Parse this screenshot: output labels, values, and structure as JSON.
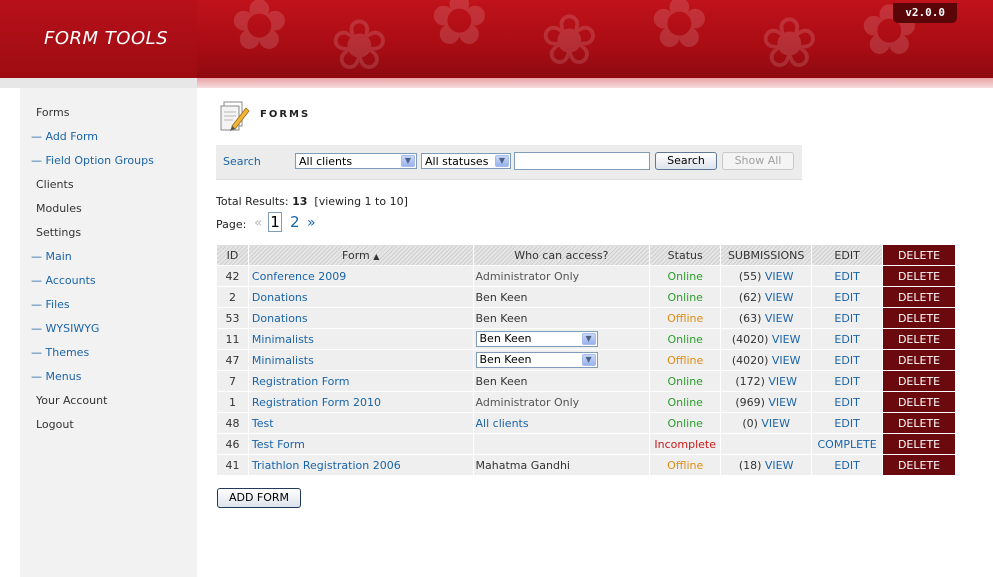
{
  "header": {
    "logo": "FORM TOOLS",
    "version": "v2.0.0"
  },
  "sidebar": {
    "items": [
      {
        "label": "Forms",
        "sub": false
      },
      {
        "label": "— Add Form",
        "sub": true
      },
      {
        "label": "— Field Option Groups",
        "sub": true
      },
      {
        "label": "Clients",
        "sub": false
      },
      {
        "label": "Modules",
        "sub": false
      },
      {
        "label": "Settings",
        "sub": false
      },
      {
        "label": "— Main",
        "sub": true
      },
      {
        "label": "— Accounts",
        "sub": true
      },
      {
        "label": "— Files",
        "sub": true
      },
      {
        "label": "— WYSIWYG",
        "sub": true
      },
      {
        "label": "— Themes",
        "sub": true
      },
      {
        "label": "— Menus",
        "sub": true
      },
      {
        "label": "Your Account",
        "sub": false
      },
      {
        "label": "Logout",
        "sub": false
      }
    ]
  },
  "page": {
    "title": "FORMS"
  },
  "search": {
    "label": "Search",
    "client_select": "All clients",
    "status_select": "All statuses",
    "keyword_value": "",
    "search_button": "Search",
    "show_all_button": "Show All"
  },
  "results": {
    "prefix": "Total Results: ",
    "total": "13",
    "viewing": "  [viewing 1 to 10]"
  },
  "pager": {
    "label": "Page:",
    "prev": "«",
    "current": "1",
    "page2": "2",
    "next": "»"
  },
  "table": {
    "headers": {
      "id": "ID",
      "form": "Form",
      "access": "Who can access?",
      "status": "Status",
      "submissions": "SUBMISSIONS",
      "edit": "EDIT",
      "delete": "DELETE"
    },
    "rows": [
      {
        "id": "42",
        "form": "Conference 2009",
        "access": "Administrator Only",
        "access_type": "admin",
        "status": "Online",
        "status_type": "online",
        "count": "(55)",
        "view": "VIEW",
        "edit": "EDIT",
        "delete": "DELETE"
      },
      {
        "id": "2",
        "form": "Donations",
        "access": "Ben Keen",
        "access_type": "text",
        "status": "Online",
        "status_type": "online",
        "count": "(62)",
        "view": "VIEW",
        "edit": "EDIT",
        "delete": "DELETE"
      },
      {
        "id": "53",
        "form": "Donations",
        "access": "Ben Keen",
        "access_type": "text",
        "status": "Offline",
        "status_type": "offline",
        "count": "(63)",
        "view": "VIEW",
        "edit": "EDIT",
        "delete": "DELETE"
      },
      {
        "id": "11",
        "form": "Minimalists",
        "access": "Ben Keen",
        "access_type": "select",
        "status": "Online",
        "status_type": "online",
        "count": "(4020)",
        "view": "VIEW",
        "edit": "EDIT",
        "delete": "DELETE"
      },
      {
        "id": "47",
        "form": "Minimalists",
        "access": "Ben Keen",
        "access_type": "select",
        "status": "Offline",
        "status_type": "offline",
        "count": "(4020)",
        "view": "VIEW",
        "edit": "EDIT",
        "delete": "DELETE"
      },
      {
        "id": "7",
        "form": "Registration Form",
        "access": "Ben Keen",
        "access_type": "text",
        "status": "Online",
        "status_type": "online",
        "count": "(172)",
        "view": "VIEW",
        "edit": "EDIT",
        "delete": "DELETE"
      },
      {
        "id": "1",
        "form": "Registration Form 2010",
        "access": "Administrator Only",
        "access_type": "admin",
        "status": "Online",
        "status_type": "online",
        "count": "(969)",
        "view": "VIEW",
        "edit": "EDIT",
        "delete": "DELETE"
      },
      {
        "id": "48",
        "form": "Test",
        "access": "All clients",
        "access_type": "link",
        "status": "Online",
        "status_type": "online",
        "count": "(0)",
        "view": "VIEW",
        "edit": "EDIT",
        "delete": "DELETE"
      },
      {
        "id": "46",
        "form": "Test Form",
        "access": "",
        "access_type": "text",
        "status": "Incomplete",
        "status_type": "incomplete",
        "count": "",
        "view": "",
        "edit": "COMPLETE",
        "delete": "DELETE"
      },
      {
        "id": "41",
        "form": "Triathlon Registration 2006",
        "access": "Mahatma Gandhi",
        "access_type": "text",
        "status": "Offline",
        "status_type": "offline",
        "count": "(18)",
        "view": "VIEW",
        "edit": "EDIT",
        "delete": "DELETE"
      }
    ]
  },
  "add_form_button": "ADD FORM",
  "colors": {
    "header_red": "#b8101a",
    "delete_bg": "#6b0a0e",
    "link": "#1a64a8",
    "online": "#2a9d2a",
    "offline": "#e08b12",
    "incomplete": "#cc1a1a"
  },
  "icons": {
    "forms_page_icon": "forms-page-icon",
    "sort_icon": "sort-asc-icon"
  }
}
